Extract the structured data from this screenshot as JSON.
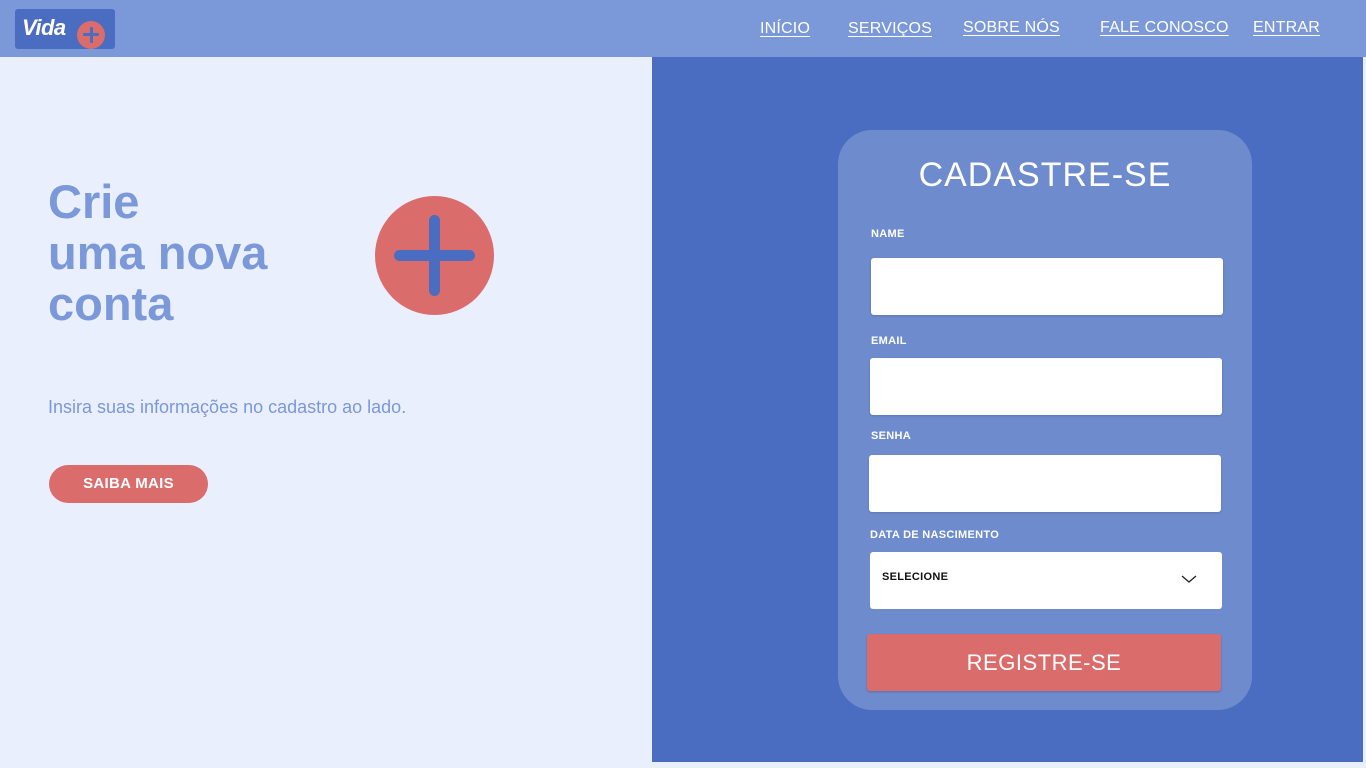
{
  "header": {
    "logo_text": "Vida",
    "nav": {
      "inicio": "INÍCIO",
      "servicos": "SERVIÇOS",
      "sobre": "SOBRE NÓS",
      "fale": "FALE CONOSCO",
      "entrar": "ENTRAR"
    }
  },
  "hero": {
    "title_line1": "Crie",
    "title_line2": "uma nova",
    "title_line3": "conta",
    "subtitle": "Insira suas informações no cadastro ao lado.",
    "cta_label": "SAIBA MAIS"
  },
  "form": {
    "title": "CADASTRE-SE",
    "name_label": "NAME",
    "name_value": "",
    "email_label": "EMAIL",
    "email_value": "",
    "senha_label": "SENHA",
    "senha_value": "",
    "dob_label": "DATA DE NASCIMENTO",
    "dob_selected": "SELECIONE",
    "submit_label": "REGISTRE-SE"
  },
  "icons": {
    "logo_plus": "plus-circle-icon",
    "hero_plus": "plus-circle-icon",
    "select_chevron": "chevron-down-icon"
  },
  "colors": {
    "header_bg": "#7B98D9",
    "panel_bg": "#4A6DC1",
    "card_bg": "#6E8BCD",
    "accent": "#DB6C6C",
    "page_bg": "#EAEFFD"
  }
}
